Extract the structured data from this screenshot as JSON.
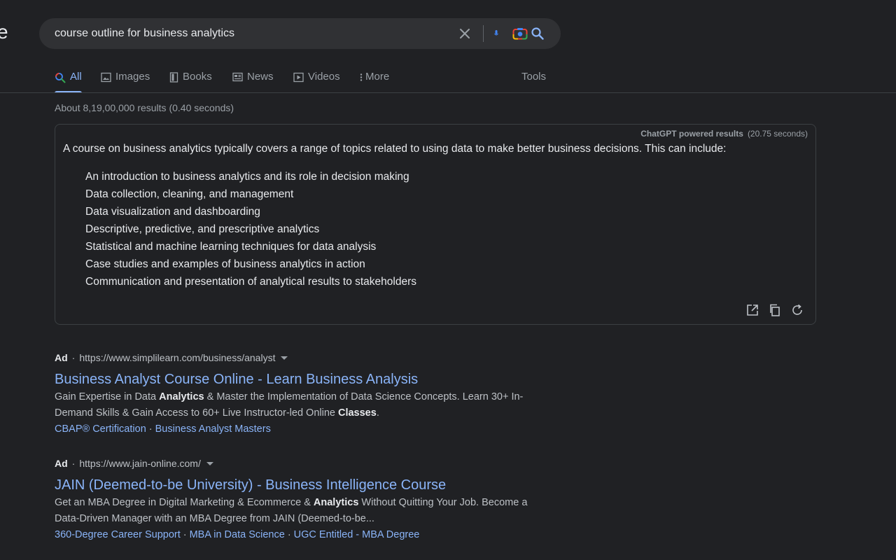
{
  "logo_fragment": "e",
  "search": {
    "query": "course outline for business analytics",
    "icons": [
      "close-icon",
      "mic-icon",
      "lens-icon",
      "search-icon"
    ]
  },
  "tabs": [
    {
      "label": "All",
      "icon": "search-icon",
      "active": true
    },
    {
      "label": "Images",
      "icon": "image-icon"
    },
    {
      "label": "Books",
      "icon": "book-icon"
    },
    {
      "label": "News",
      "icon": "news-icon"
    },
    {
      "label": "Videos",
      "icon": "video-icon"
    },
    {
      "label": "More",
      "icon": "more-vert-icon"
    },
    {
      "label": "Tools"
    }
  ],
  "result_stats": "About 8,19,00,000 results (0.40 seconds)",
  "chatgpt": {
    "source_label": "ChatGPT powered results",
    "time": "(20.75 seconds)",
    "intro": "A course on business analytics typically covers a range of topics related to using data to make better business decisions. This can include:",
    "items": [
      "An introduction to business analytics and its role in decision making",
      "Data collection, cleaning, and management",
      "Data visualization and dashboarding",
      "Descriptive, predictive, and prescriptive analytics",
      "Statistical and machine learning techniques for data analysis",
      "Case studies and examples of business analytics in action",
      "Communication and presentation of analytical results to stakeholders"
    ],
    "tool_icons": [
      "open-external-icon",
      "copy-icon",
      "refresh-icon"
    ]
  },
  "ads": [
    {
      "label": "Ad",
      "url": "https://www.simplilearn.com/business/analyst",
      "title": "Business Analyst Course Online - Learn Business Analysis",
      "desc": [
        [
          "Gain Expertise in Data ",
          false
        ],
        [
          "Analytics",
          true
        ],
        [
          " & Master the Implementation of Data Science Concepts. Learn 30+ In-Demand Skills & Gain Access to 60+ Live Instructor-led Online ",
          false
        ],
        [
          "Classes",
          true
        ],
        [
          ".",
          false
        ]
      ],
      "links": [
        "CBAP® Certification",
        "Business Analyst Masters"
      ]
    },
    {
      "label": "Ad",
      "url": "https://www.jain-online.com/",
      "title": "JAIN (Deemed-to-be University) - Business Intelligence Course",
      "desc": [
        [
          "Get an MBA Degree in Digital Marketing & Ecommerce & ",
          false
        ],
        [
          "Analytics",
          true
        ],
        [
          " Without Quitting Your Job. Become a Data-Driven Manager with an MBA Degree from JAIN (Deemed-to-be...",
          false
        ]
      ],
      "links": [
        "360-Degree Career Support",
        "MBA in Data Science",
        "UGC Entitled - MBA Degree"
      ]
    }
  ],
  "colors": {
    "background": "#202124",
    "search_box": "#303134",
    "link": "#8ab4f8",
    "text": "#e8eaed",
    "muted": "#9aa0a6"
  }
}
